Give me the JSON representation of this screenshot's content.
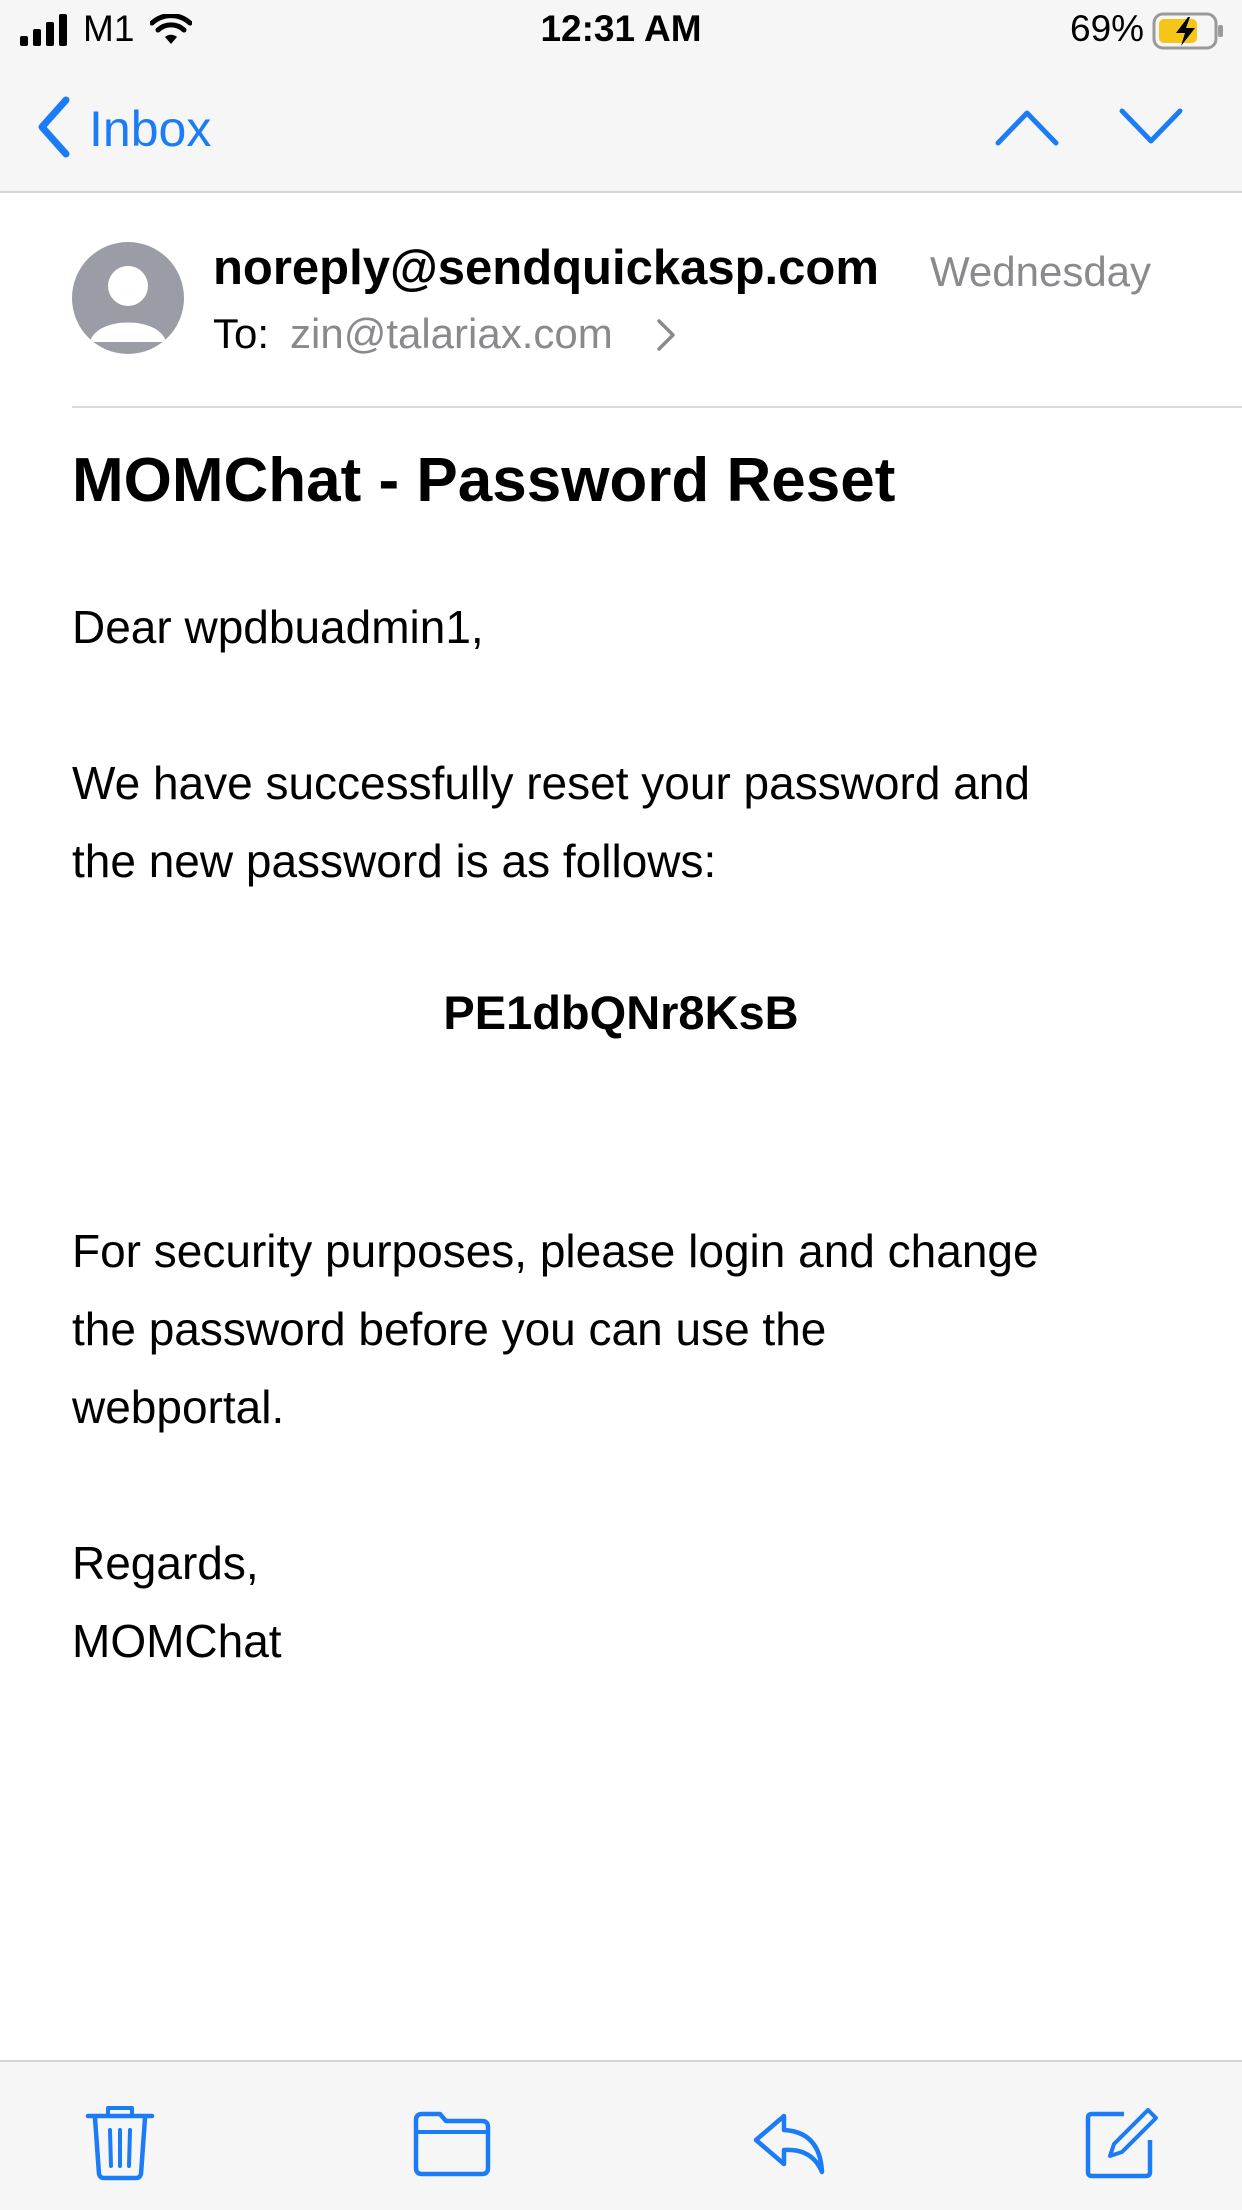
{
  "status_bar": {
    "carrier": "M1",
    "time": "12:31 AM",
    "battery_percent": "69%",
    "icons": [
      "signal-bars-icon",
      "wifi-icon",
      "battery-charging-icon"
    ]
  },
  "nav": {
    "back_label": "Inbox",
    "icons": [
      "chevron-left-icon",
      "chevron-up-icon",
      "chevron-down-icon"
    ]
  },
  "message": {
    "sender": "noreply@sendquickasp.com",
    "date": "Wednesday",
    "to_label": "To:",
    "to_value": "zin@talariax.com",
    "subject": "MOMChat - Password Reset",
    "greeting": "Dear wpdbuadmin1,",
    "para1_line1": "We have successfully reset your password and",
    "para1_line2": "the new password is as follows:",
    "password": "PE1dbQNr8KsB",
    "para2_line1": "For security purposes, please login and change",
    "para2_line2": "the password before you can use the",
    "para2_line3": "webportal.",
    "signoff": "Regards,",
    "signature": "MOMChat"
  },
  "toolbar": {
    "icons": [
      "trash-icon",
      "folder-icon",
      "reply-icon",
      "compose-icon"
    ]
  },
  "colors": {
    "accent": "#1b7cf6",
    "secondary_text": "#8a8a8e",
    "battery_charging": "#f5c518"
  }
}
